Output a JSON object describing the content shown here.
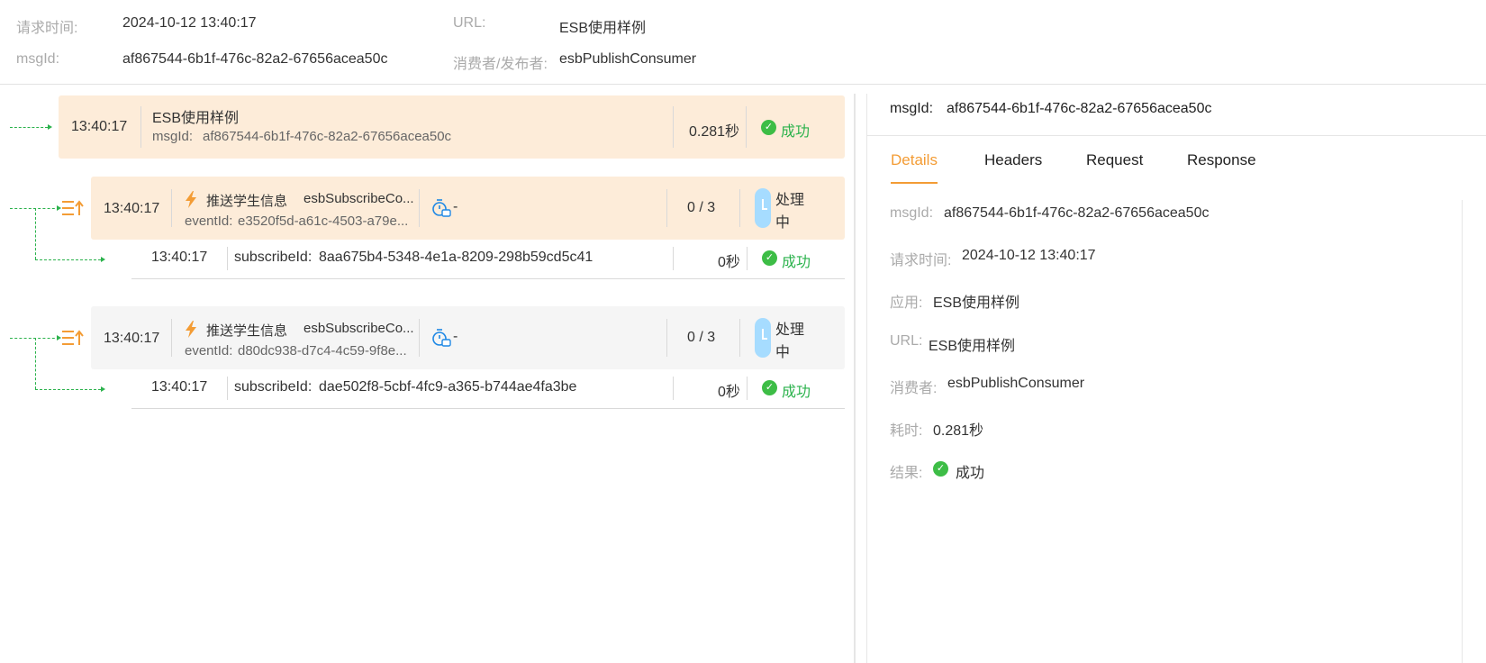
{
  "header": {
    "request_time_label": "请求时间:",
    "request_time_value": "2024-10-12 13:40:17",
    "url_label": "URL:",
    "url_value": "ESB使用样例",
    "msgid_label": "msgId:",
    "msgid_value": "af867544-6b1f-476c-82a2-67656acea50c",
    "consumer_label": "消费者/发布者:",
    "consumer_value": "esbPublishConsumer"
  },
  "timeline": {
    "root": {
      "time": "13:40:17",
      "title": "ESB使用样例",
      "msgid_label": "msgId:",
      "msgid_value": "af867544-6b1f-476c-82a2-67656acea50c",
      "duration": "0.281秒",
      "status": "成功"
    },
    "events": [
      {
        "time": "13:40:17",
        "name": "推送学生信息",
        "subscriber": "esbSubscribeCo...",
        "eventid_label": "eventId:",
        "eventid_value": "e3520f5d-a61c-4503-a79e...",
        "retry_value": "-",
        "count": "0 / 3",
        "status_line1": "处理",
        "status_line2": "中",
        "sub_time": "13:40:17",
        "sub_label": "subscribeId:",
        "sub_value": "8aa675b4-5348-4e1a-8209-298b59cd5c41",
        "sub_duration": "0秒",
        "sub_status": "成功"
      },
      {
        "time": "13:40:17",
        "name": "推送学生信息",
        "subscriber": "esbSubscribeCo...",
        "eventid_label": "eventId:",
        "eventid_value": "d80dc938-d7c4-4c59-9f8e...",
        "retry_value": "-",
        "count": "0 / 3",
        "status_line1": "处理",
        "status_line2": "中",
        "sub_time": "13:40:17",
        "sub_label": "subscribeId:",
        "sub_value": "dae502f8-5cbf-4fc9-a365-b744ae4fa3be",
        "sub_duration": "0秒",
        "sub_status": "成功"
      }
    ]
  },
  "detail": {
    "title_label": "msgId:",
    "title_value": "af867544-6b1f-476c-82a2-67656acea50c",
    "tabs": [
      "Details",
      "Headers",
      "Request",
      "Response"
    ],
    "active_tab": "Details",
    "fields": {
      "msgid_label": "msgId:",
      "msgid_value": "af867544-6b1f-476c-82a2-67656acea50c",
      "time_label": "请求时间:",
      "time_value": "2024-10-12 13:40:17",
      "app_label": "应用:",
      "app_value": "ESB使用样例",
      "url_label": "URL:",
      "url_value": "ESB使用样例",
      "consumer_label": "消费者:",
      "consumer_value": "esbPublishConsumer",
      "duration_label": "耗时:",
      "duration_value": "0.281秒",
      "result_label": "结果:",
      "result_value": "成功"
    }
  },
  "colors": {
    "accent": "#f39c35",
    "success": "#2bb24c",
    "card_orange": "#fdecd9",
    "card_gray": "#f5f5f5",
    "clock_blue": "#a6dcff",
    "icon_blue": "#1e88e5"
  },
  "icons": [
    "success-check-icon",
    "lightning-icon",
    "list-upload-icon",
    "retry-timer-icon",
    "clock-icon"
  ]
}
